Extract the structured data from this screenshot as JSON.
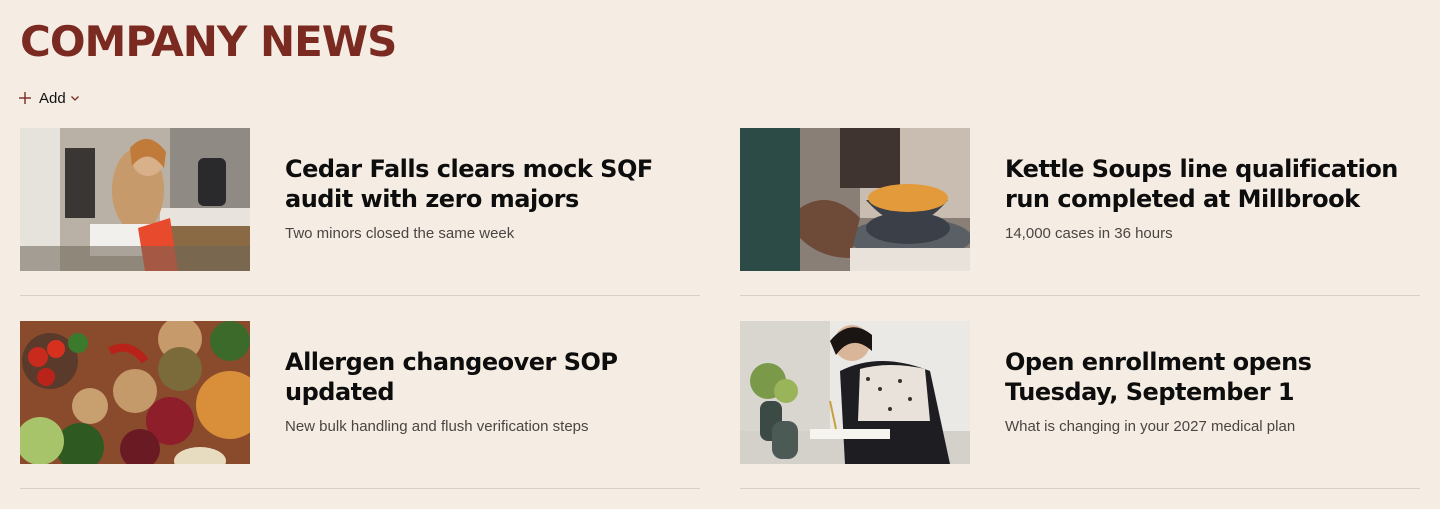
{
  "header": {
    "title": "COMPANY NEWS"
  },
  "toolbar": {
    "add_label": "Add"
  },
  "news": [
    {
      "headline": "Cedar Falls clears mock SQF audit with zero majors",
      "summary": "Two minors closed the same week"
    },
    {
      "headline": "Kettle Soups line qualification run completed at Millbrook",
      "summary": "14,000 cases in 36 hours"
    },
    {
      "headline": "Allergen changeover SOP updated",
      "summary": "New bulk handling and flush verification steps"
    },
    {
      "headline": "Open enrollment opens Tuesday, September 1",
      "summary": "What is changing in your 2027 medical plan"
    }
  ],
  "colors": {
    "background": "#f5ede4",
    "title": "#7a2a20",
    "headline": "#0d0d0d",
    "summary": "#4a4542",
    "divider": "#d8cfc6"
  }
}
